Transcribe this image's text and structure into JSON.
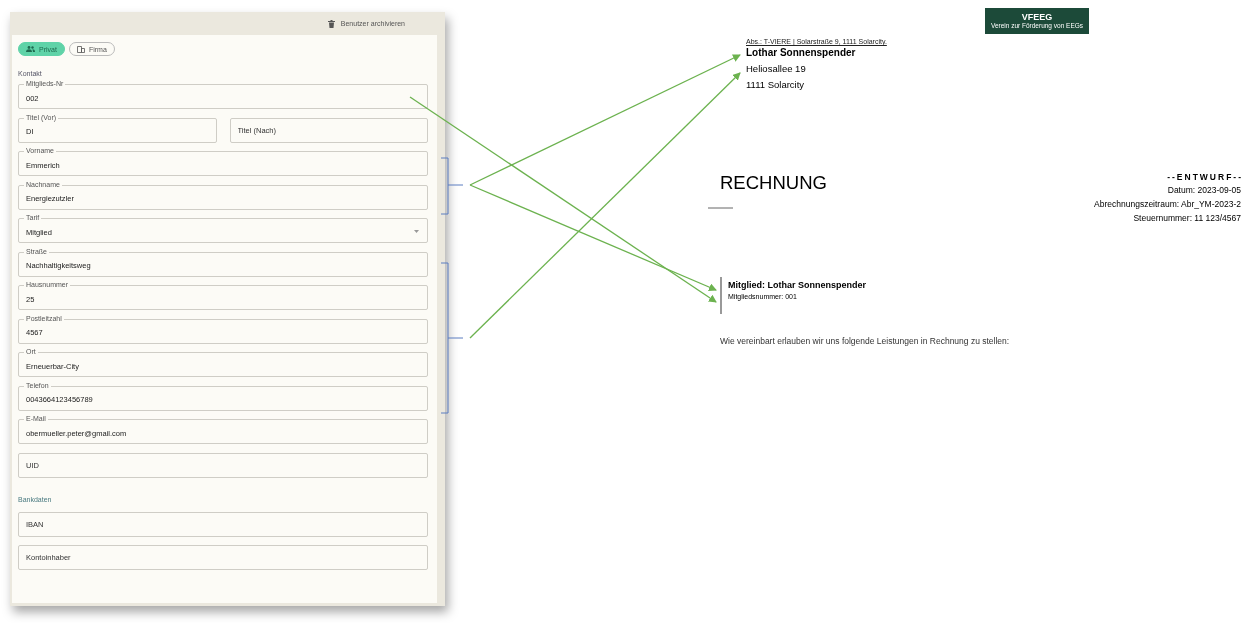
{
  "header": {
    "archive_button": "Benutzer archivieren"
  },
  "toggle": [
    {
      "label": "Privat",
      "selected": true
    },
    {
      "label": "Firma",
      "selected": false
    }
  ],
  "sections": [
    {
      "title": "Kontakt",
      "rows": [
        [
          {
            "kind": "text",
            "label": "Mitglieds-Nr",
            "value": "002"
          }
        ],
        [
          {
            "kind": "text",
            "label": "Titel (Vor)",
            "value": "DI"
          },
          {
            "kind": "empty",
            "placeholder": "Titel (Nach)"
          }
        ],
        [
          {
            "kind": "text",
            "label": "Vorname",
            "value": "Emmerich"
          }
        ],
        [
          {
            "kind": "text",
            "label": "Nachname",
            "value": "Energiezutzler"
          }
        ],
        [
          {
            "kind": "select",
            "label": "Tarif",
            "value": "Mitglied"
          }
        ],
        [
          {
            "kind": "text",
            "label": "Straße",
            "value": "Nachhaltigkeitsweg"
          }
        ],
        [
          {
            "kind": "text",
            "label": "Hausnummer",
            "value": "25"
          }
        ],
        [
          {
            "kind": "text",
            "label": "Postleitzahl",
            "value": "4567"
          }
        ],
        [
          {
            "kind": "text",
            "label": "Ort",
            "value": "Erneuerbar-City"
          }
        ],
        [
          {
            "kind": "text",
            "label": "Telefon",
            "value": "0043664123456789"
          }
        ],
        [
          {
            "kind": "text",
            "label": "E-Mail",
            "value": "obermueller.peter@gmail.com"
          }
        ],
        [
          {
            "kind": "empty",
            "placeholder": "UID"
          }
        ]
      ]
    },
    {
      "title": "Bankdaten",
      "rows": [
        [
          {
            "kind": "empty",
            "placeholder": "IBAN"
          }
        ],
        [
          {
            "kind": "empty",
            "placeholder": "Kontoinhaber"
          }
        ]
      ]
    }
  ],
  "document": {
    "logo": {
      "name": "VFEEG",
      "tagline": "Verein zur Förderung von EEGs"
    },
    "sender": "Abs.: T-VIERE | Solarstraße 9, 1111 Solarcity.",
    "recipient": [
      "Lothar Sonnenspender",
      "Heliosallee 19",
      "1111 Solarcity"
    ],
    "title": "RECHNUNG",
    "status": "--ENTWURF--",
    "meta": [
      "Datum: 2023-09-05",
      "Abrechnungszeitraum: Abr_YM-2023-2",
      "Steuernummer: 11 123/4567"
    ],
    "member": {
      "title": "Mitglied: Lothar Sonnenspender",
      "number": "Mitgliedsnummer: 001"
    },
    "intro": "Wie vereinbart erlauben wir uns folgende Leistungen in Rechnung zu stellen:"
  }
}
